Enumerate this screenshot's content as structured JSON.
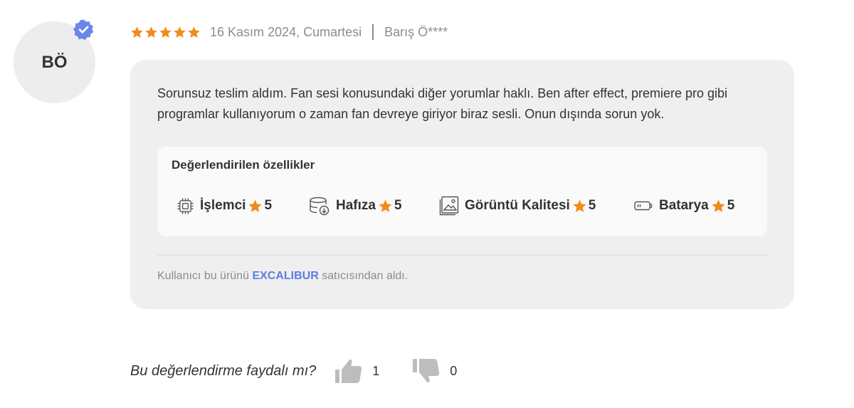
{
  "review": {
    "avatar_initials": "BÖ",
    "verified_icon": "verified-check-badge-icon",
    "rating": 5,
    "rating_max": 5,
    "date": "16 Kasım 2024, Cumartesi",
    "separator": "|",
    "author": "Barış Ö****",
    "comment": "Sorunsuz teslim aldım. Fan sesi konusundaki diğer yorumlar haklı. Ben after effect, premiere pro gibi programlar kullanıyorum o zaman fan devreye giriyor biraz sesli. Onun dışında sorun yok.",
    "features_title": "Değerlendirilen özellikler",
    "features": [
      {
        "icon": "cpu-icon",
        "label": "İşlemci",
        "score": "5"
      },
      {
        "icon": "memory-storage-icon",
        "label": "Hafıza",
        "score": "5"
      },
      {
        "icon": "image-quality-icon",
        "label": "Görüntü Kalitesi",
        "score": "5"
      },
      {
        "icon": "battery-icon",
        "label": "Batarya",
        "score": "5"
      }
    ],
    "seller_prefix": "Kullanıcı bu ürünü",
    "seller_name": "EXCALIBUR",
    "seller_suffix": "satıcısından aldı."
  },
  "helpful": {
    "question": "Bu değerlendirme faydalı mı?",
    "up_count": "1",
    "down_count": "0"
  },
  "colors": {
    "star": "#f28b1a",
    "verified": "#6b86e8",
    "seller_link": "#5b7fe0",
    "card_bg": "#efefef",
    "thumb": "#bdbdbd"
  }
}
